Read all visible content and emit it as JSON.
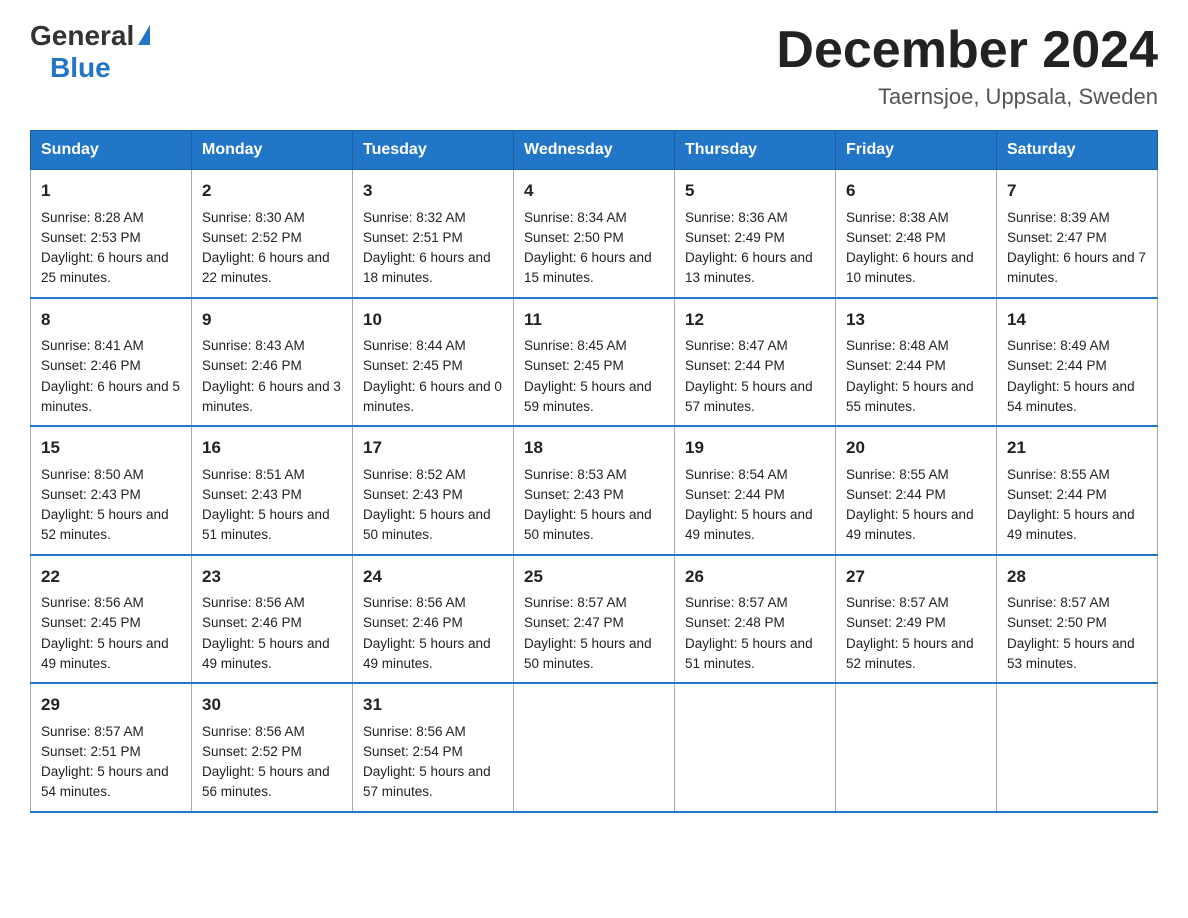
{
  "header": {
    "logo_general": "General",
    "logo_blue": "Blue",
    "month_title": "December 2024",
    "location": "Taernsjoe, Uppsala, Sweden"
  },
  "days_of_week": [
    "Sunday",
    "Monday",
    "Tuesday",
    "Wednesday",
    "Thursday",
    "Friday",
    "Saturday"
  ],
  "weeks": [
    [
      {
        "day": "1",
        "sunrise": "8:28 AM",
        "sunset": "2:53 PM",
        "daylight": "6 hours and 25 minutes."
      },
      {
        "day": "2",
        "sunrise": "8:30 AM",
        "sunset": "2:52 PM",
        "daylight": "6 hours and 22 minutes."
      },
      {
        "day": "3",
        "sunrise": "8:32 AM",
        "sunset": "2:51 PM",
        "daylight": "6 hours and 18 minutes."
      },
      {
        "day": "4",
        "sunrise": "8:34 AM",
        "sunset": "2:50 PM",
        "daylight": "6 hours and 15 minutes."
      },
      {
        "day": "5",
        "sunrise": "8:36 AM",
        "sunset": "2:49 PM",
        "daylight": "6 hours and 13 minutes."
      },
      {
        "day": "6",
        "sunrise": "8:38 AM",
        "sunset": "2:48 PM",
        "daylight": "6 hours and 10 minutes."
      },
      {
        "day": "7",
        "sunrise": "8:39 AM",
        "sunset": "2:47 PM",
        "daylight": "6 hours and 7 minutes."
      }
    ],
    [
      {
        "day": "8",
        "sunrise": "8:41 AM",
        "sunset": "2:46 PM",
        "daylight": "6 hours and 5 minutes."
      },
      {
        "day": "9",
        "sunrise": "8:43 AM",
        "sunset": "2:46 PM",
        "daylight": "6 hours and 3 minutes."
      },
      {
        "day": "10",
        "sunrise": "8:44 AM",
        "sunset": "2:45 PM",
        "daylight": "6 hours and 0 minutes."
      },
      {
        "day": "11",
        "sunrise": "8:45 AM",
        "sunset": "2:45 PM",
        "daylight": "5 hours and 59 minutes."
      },
      {
        "day": "12",
        "sunrise": "8:47 AM",
        "sunset": "2:44 PM",
        "daylight": "5 hours and 57 minutes."
      },
      {
        "day": "13",
        "sunrise": "8:48 AM",
        "sunset": "2:44 PM",
        "daylight": "5 hours and 55 minutes."
      },
      {
        "day": "14",
        "sunrise": "8:49 AM",
        "sunset": "2:44 PM",
        "daylight": "5 hours and 54 minutes."
      }
    ],
    [
      {
        "day": "15",
        "sunrise": "8:50 AM",
        "sunset": "2:43 PM",
        "daylight": "5 hours and 52 minutes."
      },
      {
        "day": "16",
        "sunrise": "8:51 AM",
        "sunset": "2:43 PM",
        "daylight": "5 hours and 51 minutes."
      },
      {
        "day": "17",
        "sunrise": "8:52 AM",
        "sunset": "2:43 PM",
        "daylight": "5 hours and 50 minutes."
      },
      {
        "day": "18",
        "sunrise": "8:53 AM",
        "sunset": "2:43 PM",
        "daylight": "5 hours and 50 minutes."
      },
      {
        "day": "19",
        "sunrise": "8:54 AM",
        "sunset": "2:44 PM",
        "daylight": "5 hours and 49 minutes."
      },
      {
        "day": "20",
        "sunrise": "8:55 AM",
        "sunset": "2:44 PM",
        "daylight": "5 hours and 49 minutes."
      },
      {
        "day": "21",
        "sunrise": "8:55 AM",
        "sunset": "2:44 PM",
        "daylight": "5 hours and 49 minutes."
      }
    ],
    [
      {
        "day": "22",
        "sunrise": "8:56 AM",
        "sunset": "2:45 PM",
        "daylight": "5 hours and 49 minutes."
      },
      {
        "day": "23",
        "sunrise": "8:56 AM",
        "sunset": "2:46 PM",
        "daylight": "5 hours and 49 minutes."
      },
      {
        "day": "24",
        "sunrise": "8:56 AM",
        "sunset": "2:46 PM",
        "daylight": "5 hours and 49 minutes."
      },
      {
        "day": "25",
        "sunrise": "8:57 AM",
        "sunset": "2:47 PM",
        "daylight": "5 hours and 50 minutes."
      },
      {
        "day": "26",
        "sunrise": "8:57 AM",
        "sunset": "2:48 PM",
        "daylight": "5 hours and 51 minutes."
      },
      {
        "day": "27",
        "sunrise": "8:57 AM",
        "sunset": "2:49 PM",
        "daylight": "5 hours and 52 minutes."
      },
      {
        "day": "28",
        "sunrise": "8:57 AM",
        "sunset": "2:50 PM",
        "daylight": "5 hours and 53 minutes."
      }
    ],
    [
      {
        "day": "29",
        "sunrise": "8:57 AM",
        "sunset": "2:51 PM",
        "daylight": "5 hours and 54 minutes."
      },
      {
        "day": "30",
        "sunrise": "8:56 AM",
        "sunset": "2:52 PM",
        "daylight": "5 hours and 56 minutes."
      },
      {
        "day": "31",
        "sunrise": "8:56 AM",
        "sunset": "2:54 PM",
        "daylight": "5 hours and 57 minutes."
      },
      null,
      null,
      null,
      null
    ]
  ]
}
